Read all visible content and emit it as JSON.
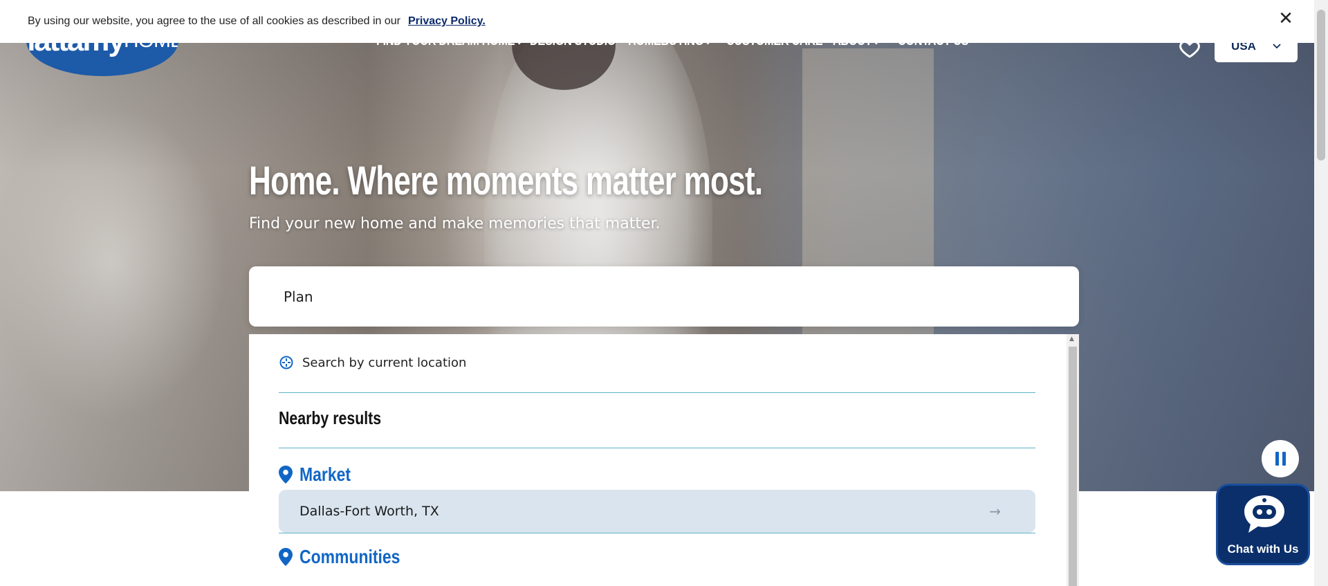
{
  "cookie_banner": {
    "text": "By using our website, you agree to the use of all cookies as described in our",
    "link_label": "Privacy Policy.",
    "close_icon": "close-icon"
  },
  "header": {
    "logo": {
      "part1": "mattamy",
      "part2": "HOMES"
    },
    "nav": [
      {
        "label": "FIND YOUR DREAM HOME",
        "has_dropdown": true
      },
      {
        "label": "DESIGN STUDIO",
        "has_dropdown": false
      },
      {
        "label": "HOMEBUYING",
        "has_dropdown": true
      },
      {
        "label": "CUSTOMER CARE",
        "has_dropdown": false
      },
      {
        "label": "ABOUT",
        "has_dropdown": true
      },
      {
        "label": "CONTACT US",
        "has_dropdown": false
      }
    ],
    "favorites_icon": "heart-icon",
    "country": {
      "label": "USA",
      "icon": "chevron-down-icon"
    }
  },
  "hero": {
    "title": "Home. Where moments matter most.",
    "subtitle": "Find your new home and make memories that matter."
  },
  "search": {
    "value": "Plan",
    "dropdown": {
      "current_location": {
        "label": "Search by current location",
        "icon": "crosshair-icon"
      },
      "nearby_heading": "Nearby results",
      "sections": [
        {
          "title": "Market",
          "icon": "location-pin-icon",
          "results": [
            "Dallas-Fort Worth, TX"
          ]
        },
        {
          "title": "Communities",
          "icon": "location-pin-icon",
          "results": []
        }
      ]
    }
  },
  "controls": {
    "pause_icon": "pause-icon",
    "chat_label": "Chat with Us",
    "chat_icon": "chatbot-icon"
  },
  "colors": {
    "brand_blue": "#1166c5",
    "navy": "#0b2f6b",
    "divider": "#5bb3c6",
    "highlight_row": "#d9e4ee"
  }
}
